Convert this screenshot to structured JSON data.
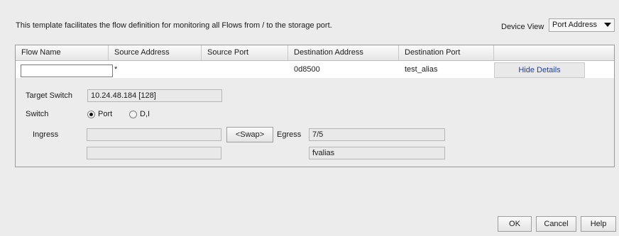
{
  "description": "This template facilitates the flow definition for monitoring all Flows from / to the storage port.",
  "device_view": {
    "label": "Device View",
    "selected": "Port Address"
  },
  "table": {
    "headers": [
      "Flow Name",
      "Source Address",
      "Source Port",
      "Destination Address",
      "Destination Port"
    ],
    "row": {
      "flow_name": "",
      "source_address": "*",
      "source_port": "",
      "destination_address": "0d8500",
      "destination_port": "test_alias",
      "action": "Hide Details"
    }
  },
  "details": {
    "target_switch_label": "Target Switch",
    "target_switch_value": "10.24.48.184 [128]",
    "switch_label": "Switch",
    "switch_options": [
      "Port",
      "D,I"
    ],
    "switch_selected": "Port",
    "ingress_label": "Ingress",
    "ingress_value": "",
    "ingress_alias": "",
    "swap_label": "<Swap>",
    "egress_label": "Egress",
    "egress_value": "7/5",
    "egress_alias": "fvalias"
  },
  "buttons": {
    "ok": "OK",
    "cancel": "Cancel",
    "help": "Help"
  }
}
